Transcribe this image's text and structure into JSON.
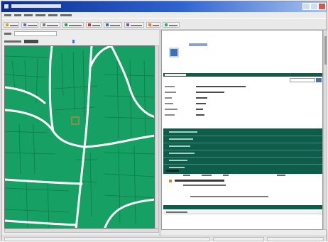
{
  "window": {
    "title": "",
    "controls": [
      "minimize-icon",
      "maximize-icon",
      "close-icon"
    ],
    "colors": {
      "titlebar": "#0b2f8f",
      "map": "#17a063",
      "road": "#ffffff",
      "panel_accent": "#0d5d4b"
    }
  },
  "menu": {
    "items": [
      "",
      "",
      "",
      "",
      "",
      ""
    ]
  },
  "toolbar": {
    "buttons": [
      {
        "label": "",
        "icon": "open-icon"
      },
      {
        "label": "",
        "icon": "save-icon"
      },
      {
        "label": "",
        "icon": "print-icon"
      },
      {
        "label": "",
        "icon": "identify-icon"
      },
      {
        "label": "",
        "icon": "search-icon"
      },
      {
        "label": "",
        "icon": "report-icon"
      },
      {
        "label": "",
        "icon": "layers-icon"
      },
      {
        "label": "",
        "icon": "zoom-icon"
      },
      {
        "label": "",
        "icon": "help-icon"
      }
    ]
  },
  "map_view": {
    "location_value": "",
    "scale_value": ""
  },
  "details": {
    "header_title": "",
    "section_title": "",
    "search_value": "",
    "fields": [
      {
        "label": "",
        "value": ""
      },
      {
        "label": "",
        "value": ""
      },
      {
        "label": "",
        "value": ""
      },
      {
        "label": "",
        "value": ""
      },
      {
        "label": "",
        "value": ""
      },
      {
        "label": "",
        "value": ""
      }
    ],
    "links": [
      "",
      "",
      "",
      "",
      "",
      ""
    ],
    "summary": {
      "title": "",
      "columns": [
        "",
        "",
        "",
        ""
      ],
      "rows": [
        "",
        ""
      ]
    },
    "footer_link": "",
    "bottom_section_title": ""
  },
  "statusbar": {
    "segments": [
      "",
      "",
      ""
    ]
  }
}
